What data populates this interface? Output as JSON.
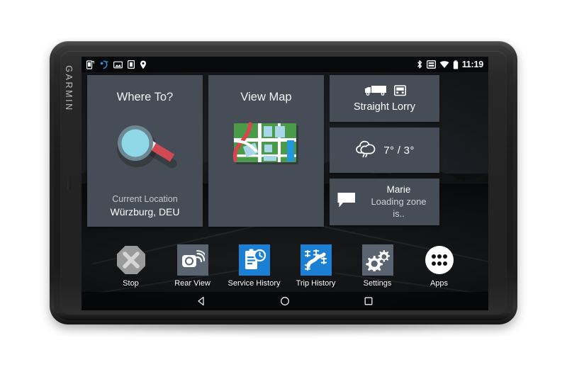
{
  "device": {
    "brand": "GARMIN"
  },
  "status_bar": {
    "left_icons": [
      {
        "name": "phone-link-icon",
        "glyph": "phone"
      },
      {
        "name": "garmin-drive-icon",
        "glyph": "garmin"
      },
      {
        "name": "photo-icon",
        "glyph": "photo"
      },
      {
        "name": "sd-card-icon",
        "glyph": "sdcard"
      },
      {
        "name": "location-pin-icon",
        "glyph": "pin"
      }
    ],
    "right_icons": [
      {
        "name": "bluetooth-icon",
        "glyph": "bluetooth"
      },
      {
        "name": "cast-screen-icon",
        "glyph": "cast"
      },
      {
        "name": "wifi-icon",
        "glyph": "wifi"
      },
      {
        "name": "battery-icon",
        "glyph": "battery"
      }
    ],
    "clock": "11:19"
  },
  "tiles": {
    "where_to": {
      "title": "Where To?",
      "sub_label": "Current Location",
      "sub_value": "Würzburg, DEU",
      "icon": "magnifier-icon"
    },
    "view_map": {
      "title": "View Map",
      "icon": "map-icon"
    }
  },
  "widgets": {
    "vehicle": {
      "label": "Straight Lorry",
      "icons": [
        "truck-side-icon",
        "truck-front-icon"
      ]
    },
    "weather": {
      "icon": "cloud-rain-icon",
      "temperature": "7° / 3°",
      "high": "7°",
      "low": "3°"
    },
    "message": {
      "icon": "speech-bubble-icon",
      "sender": "Marie",
      "preview": "Loading zone is.."
    }
  },
  "dock": {
    "apps": [
      {
        "label": "Stop",
        "icon": "stop-octagon-icon",
        "style": "plain"
      },
      {
        "label": "Rear View",
        "icon": "rear-camera-icon",
        "style": "slate"
      },
      {
        "label": "Service History",
        "icon": "clipboard-clock-icon",
        "style": "blue"
      },
      {
        "label": "Trip History",
        "icon": "trip-route-icon",
        "style": "blue"
      },
      {
        "label": "Settings",
        "icon": "gears-icon",
        "style": "slate"
      },
      {
        "label": "Apps",
        "icon": "app-grid-icon",
        "style": "white"
      }
    ]
  },
  "navbar": {
    "buttons": [
      {
        "name": "back-button",
        "icon": "triangle-back-icon"
      },
      {
        "name": "home-button",
        "icon": "circle-home-icon"
      },
      {
        "name": "recents-button",
        "icon": "square-recents-icon"
      }
    ]
  },
  "colors": {
    "tile_bg": "#474d56",
    "accent_blue": "#1b7fd4",
    "slate": "#5a6470",
    "lens_cyan": "#8fd8e8",
    "handle_red": "#cf4a52",
    "map_green": "#4a9a4a"
  }
}
